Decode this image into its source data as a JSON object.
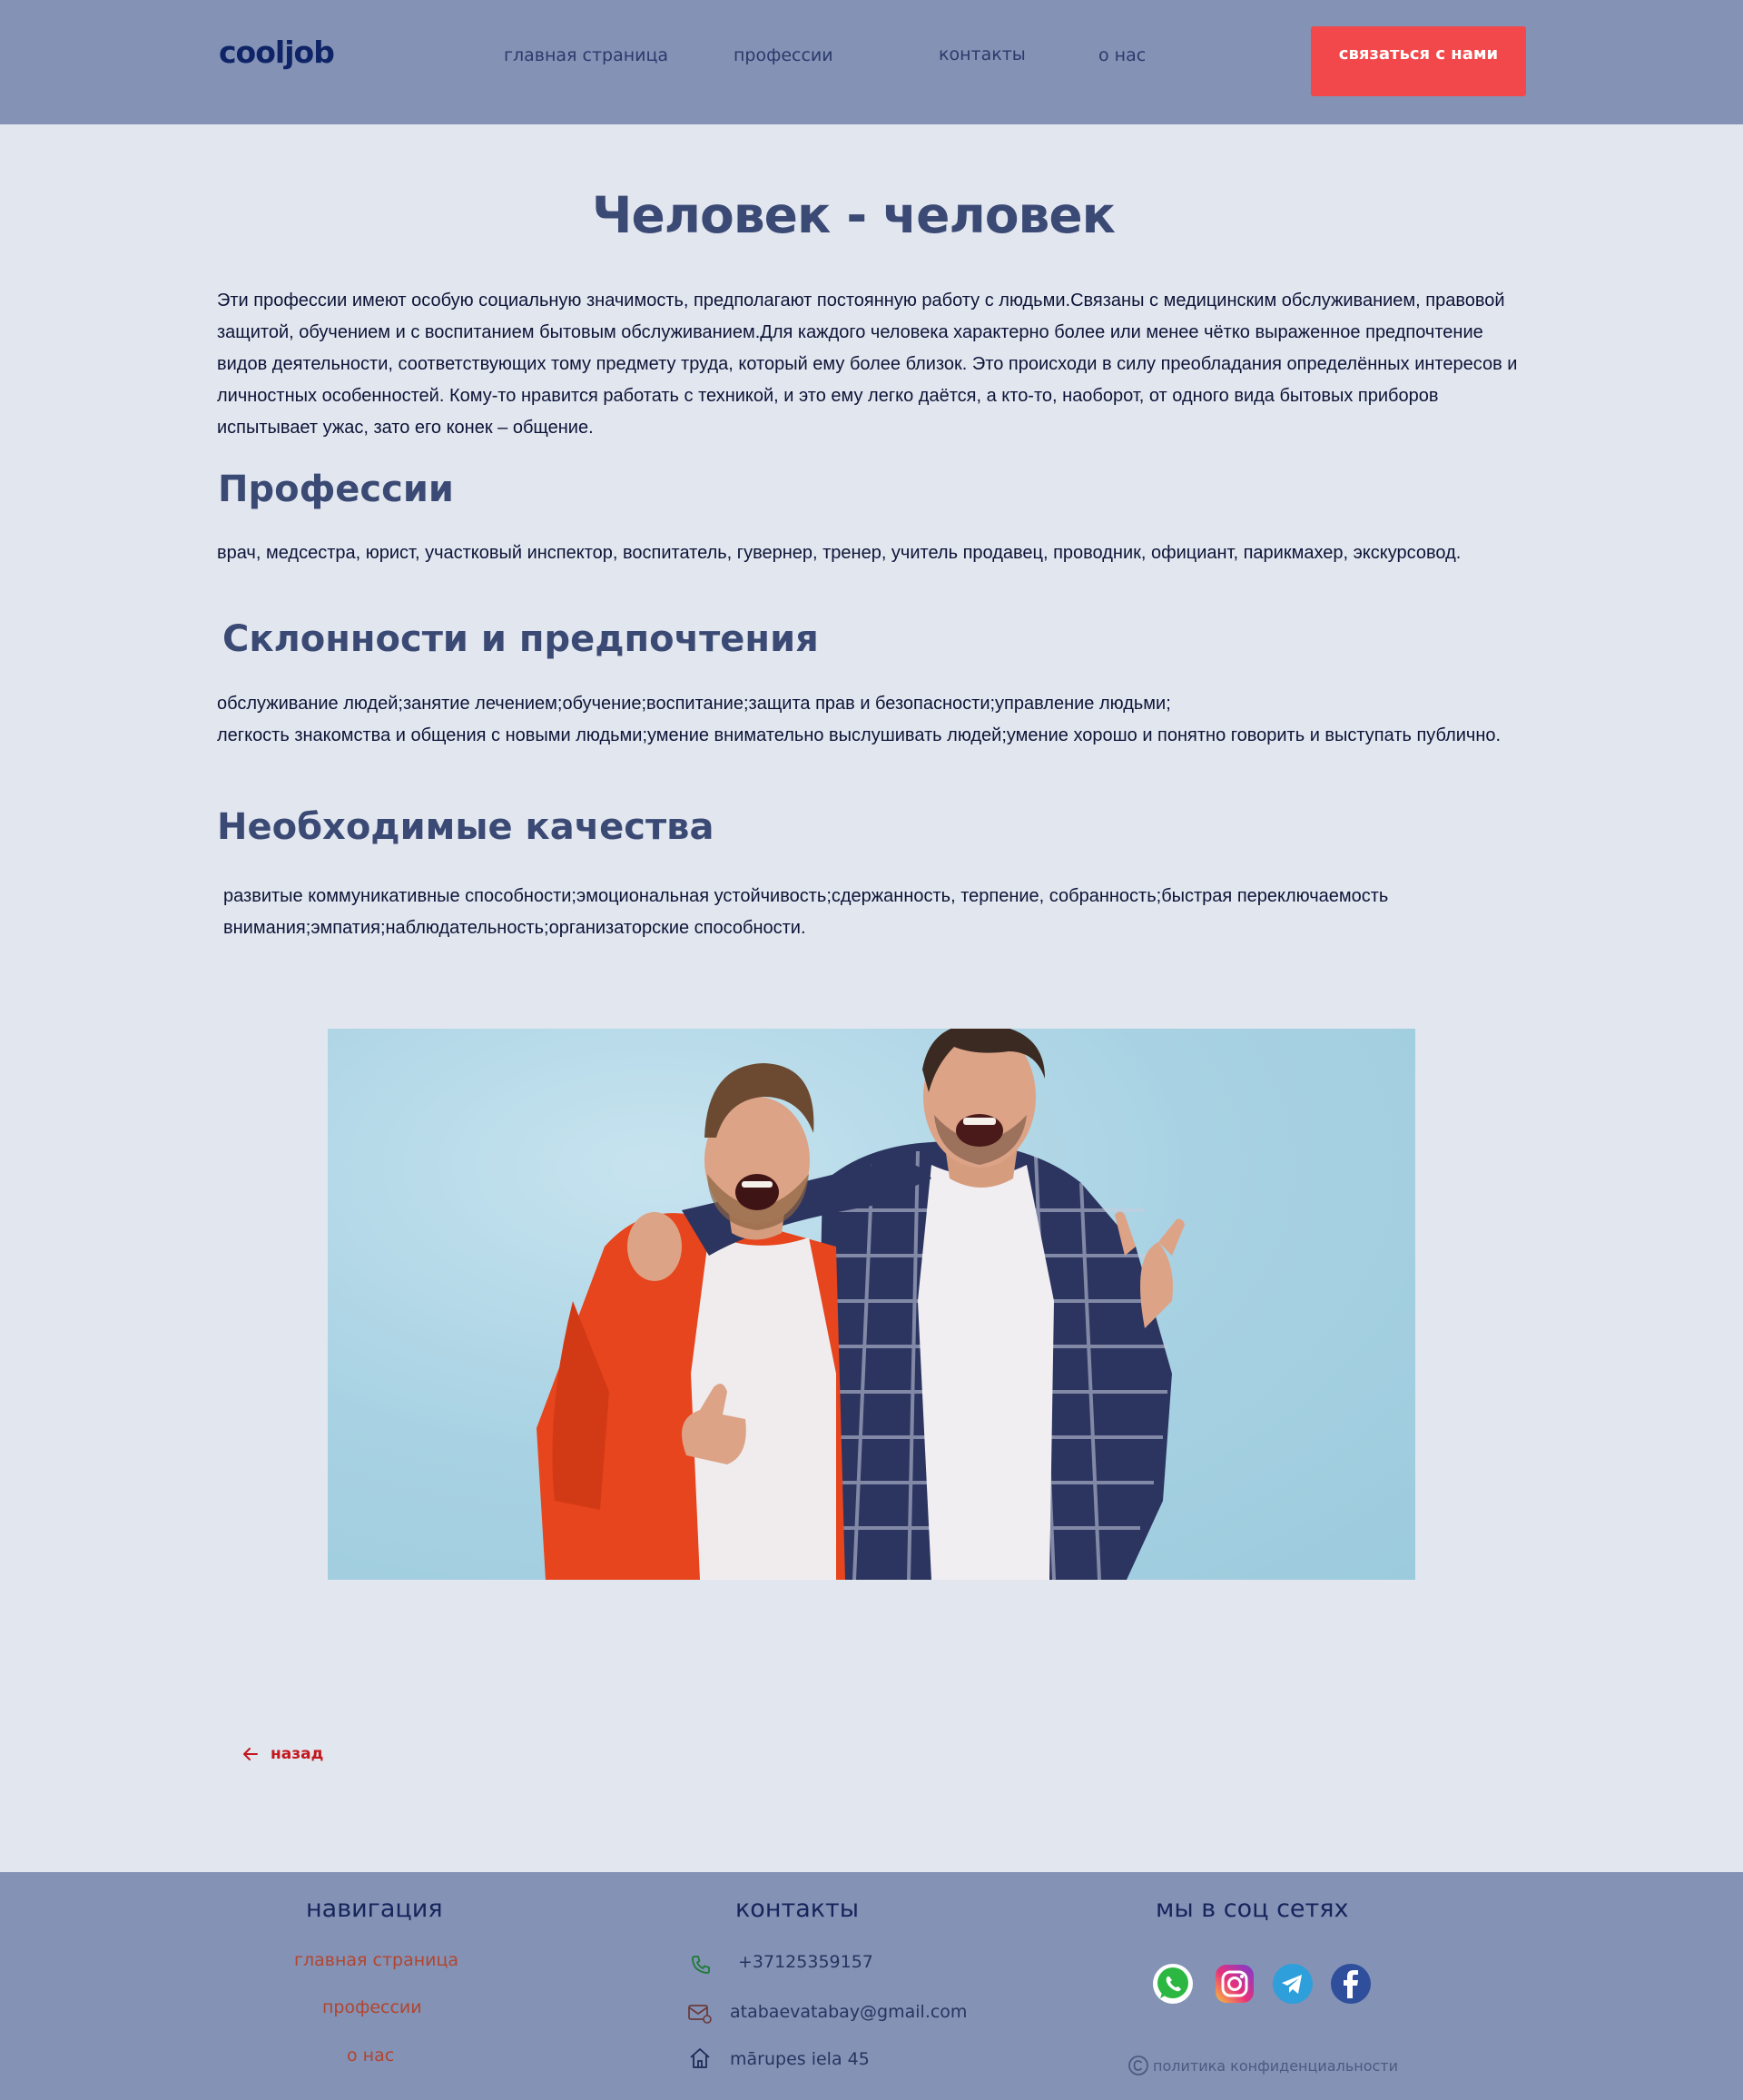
{
  "header": {
    "logo": "cooljob",
    "nav": [
      "главная страница",
      "профессии",
      "контакты",
      "о нас"
    ],
    "cta": "связаться с нами"
  },
  "main": {
    "title": "Человек - человек",
    "intro": [
      "Эти профессии имеют особую социальную значимость, предполагают постоянную работу с людьми.Связаны с медицинским обслуживанием, правовой",
      "защитой, обучением и с воспитанием бытовым обслуживанием.Для каждого человека характерно более или менее чётко выраженное предпочтение",
      "видов деятельности, соответствующих тому предмету труда, который ему более близок. Это происходи в силу преобладания определённых интересов и",
      "личностных особенностей. Кому-то нравится работать с техникой, и это ему легко даётся, а кто-то, наоборот, от одного вида бытовых приборов",
      "испытывает ужас, зато его конек – общение."
    ],
    "professions_title": "Профессии",
    "professions_text": "врач, медсестра, юрист, участковый инспектор, воспитатель, гувернер, тренер, учитель продавец, проводник, официант, парикмахер, экскурсовод.",
    "inclinations_title": "Склонности и предпочтения",
    "inclinations_text": [
      "обслуживание людей;занятие лечением;обучение;воспитание;защита прав и безопасности;управление людьми;",
      "легкость знакомства и общения с новыми людьми;умение внимательно выслушивать людей;умение хорошо и понятно говорить и выступать публично."
    ],
    "qualities_title": "Необходимые качества",
    "qualities_text": [
      "развитые коммуникативные способности;эмоциональная устойчивость;сдержанность, терпение, собранность;быстрая переключаемость",
      "внимания;эмпатия;наблюдательность;организаторские способности."
    ],
    "back_label": "назад"
  },
  "footer": {
    "nav_title": "навигация",
    "nav_links": [
      "главная страница",
      "профессии",
      "о нас"
    ],
    "contacts_title": "контакты",
    "phone": "+37125359157",
    "email": "atabaevatabay@gmail.com",
    "address": "mārupes iela 45",
    "social_title": "мы в соц сетях",
    "social_icons": [
      "whatsapp-icon",
      "instagram-icon",
      "telegram-icon",
      "facebook-icon"
    ],
    "privacy": "политика конфиденциальности"
  },
  "colors": {
    "header_bg": "#8392b5",
    "page_bg": "#e2e6ef",
    "cta_bg": "#f2484b",
    "heading": "#3b4a74",
    "back_link": "#c4161c",
    "footer_link": "#b3452e"
  }
}
